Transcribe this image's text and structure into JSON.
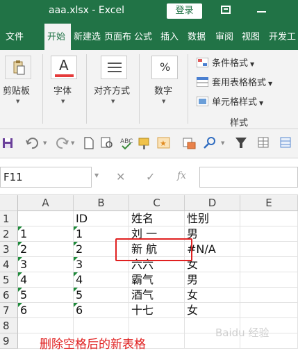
{
  "window": {
    "title": "aaa.xlsx  -  Excel",
    "login": "登录",
    "restore_icon": "restore-icon",
    "minimize_icon": "minimize-icon"
  },
  "tabs": [
    "文件",
    "开始",
    "新建选",
    "页面布",
    "公式",
    "插入",
    "数据",
    "审阅",
    "视图",
    "开发工"
  ],
  "active_tab": "开始",
  "ribbon": {
    "clipboard": "剪贴板",
    "font": "字体",
    "align": "对齐方式",
    "number": "数字",
    "number_glyph": "%",
    "font_glyph": "A",
    "conditional": "条件格式",
    "table_format": "套用表格格式",
    "cell_style": "单元格样式",
    "styles_group": "样式"
  },
  "formula_bar": {
    "name_box": "F11",
    "cancel": "✕",
    "enter": "✓",
    "fx": "fx",
    "value": ""
  },
  "sheet": {
    "columns": [
      "A",
      "B",
      "C",
      "D",
      "E"
    ],
    "rows": [
      "1",
      "2",
      "3",
      "4",
      "5",
      "6",
      "7",
      "8",
      "9"
    ],
    "cells": [
      [
        "",
        "ID",
        "姓名",
        "性别",
        ""
      ],
      [
        "1",
        "1",
        "刘 一",
        "男",
        ""
      ],
      [
        "2",
        "2",
        "新 航",
        "  #N/A",
        ""
      ],
      [
        "3",
        "3",
        "六六",
        "女",
        ""
      ],
      [
        "4",
        "4",
        "霸气",
        "男",
        ""
      ],
      [
        "5",
        "5",
        "酒气",
        "女",
        ""
      ],
      [
        "6",
        "6",
        "十七",
        "女",
        ""
      ],
      [
        "",
        "",
        "",
        "",
        ""
      ],
      [
        "",
        "",
        "",
        "",
        ""
      ]
    ],
    "caption": "删除空格后的新表格"
  },
  "colors": {
    "excel_green": "#217346",
    "highlight_red": "#e02020",
    "error_triangle": "#1e8a3a"
  },
  "watermark": "Baidu 经验"
}
